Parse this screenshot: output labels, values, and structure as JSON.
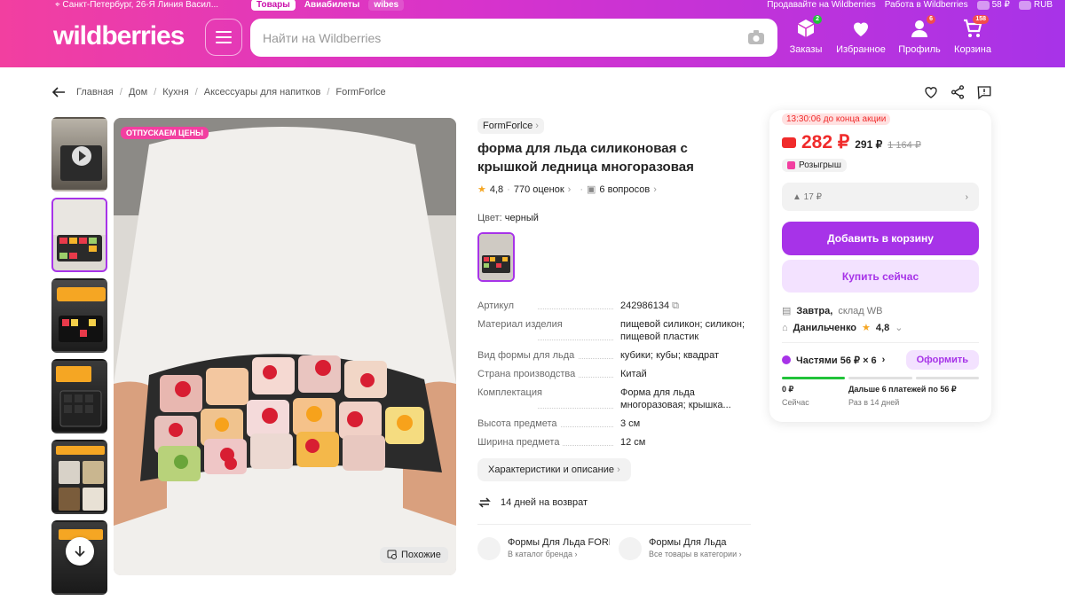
{
  "topbar": {
    "location": "Санкт-Петербург, 26-Я Линия Васил...",
    "tabs": [
      "Товары",
      "Авиабилеты",
      "wibes"
    ],
    "sell_link": "Продавайте на Wildberries",
    "work_link": "Работа в Wildberries",
    "balance": "58 ₽",
    "currency": "RUB"
  },
  "header": {
    "logo": "wildberries",
    "search_placeholder": "Найти на Wildberries",
    "nav": [
      {
        "label": "Заказы",
        "badge": "2",
        "icon": "box-icon"
      },
      {
        "label": "Избранное",
        "badge": "",
        "icon": "heart-icon"
      },
      {
        "label": "Профиль",
        "badge": "6",
        "icon": "user-icon"
      },
      {
        "label": "Корзина",
        "badge": "158",
        "icon": "cart-icon"
      }
    ]
  },
  "breadcrumbs": [
    "Главная",
    "Дом",
    "Кухня",
    "Аксессуары для напитков",
    "FormForlce"
  ],
  "gallery": {
    "promo_label": "ОТПУСКАЕМ ЦЕНЫ",
    "similar_label": "Похожие"
  },
  "product": {
    "brand": "FormForlce",
    "title": "форма для льда силиконовая с крышкой ледница многоразовая",
    "rating": "4,8",
    "reviews": "770 оценок",
    "questions": "6 вопросов",
    "color_label": "Цвет:",
    "color_value": "черный",
    "specs": [
      {
        "k": "Артикул",
        "v": "242986134"
      },
      {
        "k": "Материал изделия",
        "v": "пищевой силикон; силикон; пищевой пластик"
      },
      {
        "k": "Вид формы для льда",
        "v": "кубики; кубы; квадрат"
      },
      {
        "k": "Страна производства",
        "v": "Китай"
      },
      {
        "k": "Комплектация",
        "v": "Форма для льда многоразовая; крышка..."
      },
      {
        "k": "Высота предмета",
        "v": "3 см"
      },
      {
        "k": "Ширина предмета",
        "v": "12 см"
      }
    ],
    "char_button": "Характеристики и описание",
    "return_text": "14 дней на возврат",
    "cat1_title": "Формы Для Льда FORM",
    "cat1_sub": "В каталог бренда",
    "cat2_title": "Формы Для Льда",
    "cat2_sub": "Все товары в категории"
  },
  "buybox": {
    "timer": "13:30:06 до конца акции",
    "price": "282 ₽",
    "price2": "291 ₽",
    "old_price": "1 164 ₽",
    "raffle": "Розыгрыш",
    "cashback": "▲ 17 ₽",
    "add_to_cart": "Добавить в корзину",
    "buy_now": "Купить сейчас",
    "delivery_day": "Завтра,",
    "delivery_wh": "склад WB",
    "seller": "Данильченко",
    "seller_rating": "4,8",
    "installments": "Частями 56 ₽ × 6",
    "oform": "Оформить",
    "pay_now": "0 ₽",
    "pay_now_sub": "Сейчас",
    "pay_later": "Дальше 6 платежей по 56 ₽",
    "pay_later_sub": "Раз в 14 дней"
  },
  "colors": {
    "accent": "#a733e8",
    "price_red": "#f02b2b",
    "pink": "#f23fa0"
  }
}
